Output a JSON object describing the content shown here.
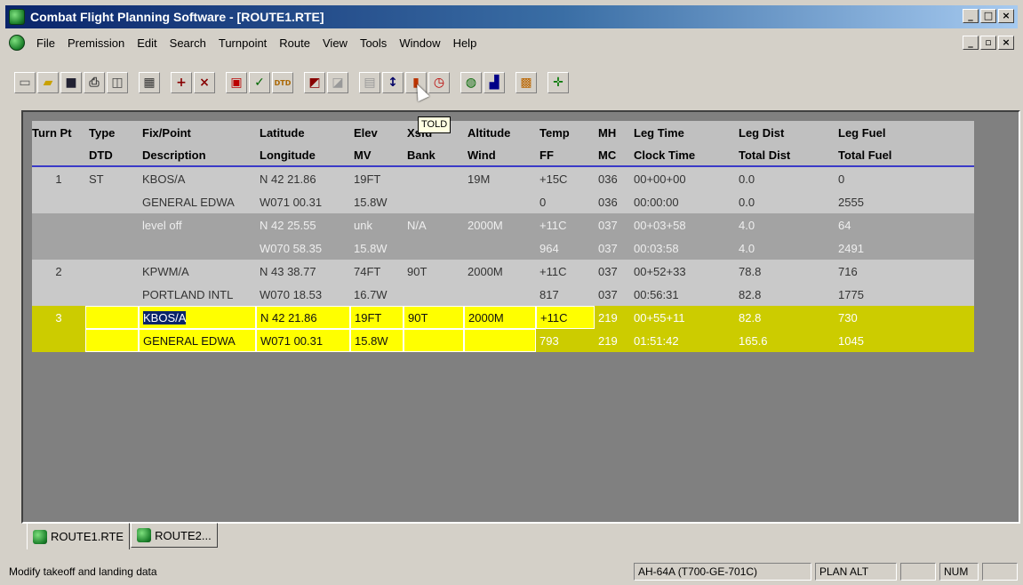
{
  "window": {
    "title": "Combat Flight Planning Software - [ROUTE1.RTE]"
  },
  "menu": [
    "File",
    "Premission",
    "Edit",
    "Search",
    "Turnpoint",
    "Route",
    "View",
    "Tools",
    "Window",
    "Help"
  ],
  "toolbar": {
    "buttons": [
      "new-icon",
      "open-icon",
      "save-icon",
      "print-icon",
      "print-preview-icon",
      "calculator-icon",
      "insert-turnpoint-icon",
      "delete-turnpoint-icon",
      "flight-plan-icon",
      "check-icon",
      "dtd-icon",
      "told-icon",
      "disabled-icon",
      "settings-icon",
      "vertical-icon",
      "weight-icon",
      "clock-icon",
      "globe-icon",
      "chart-icon",
      "dtd-load-icon",
      "crosshair-icon"
    ],
    "tooltip": "TOLD"
  },
  "grid": {
    "header_row1": [
      "Turn Pt",
      "Type",
      "Fix/Point",
      "Latitude",
      "Elev",
      "Xsfd",
      "Altitude",
      "Temp",
      "MH",
      "Leg Time",
      "Leg Dist",
      "Leg Fuel"
    ],
    "header_row2": [
      "",
      "DTD",
      "Description",
      "Longitude",
      "MV",
      "Bank",
      "Wind",
      "FF",
      "MC",
      "Clock Time",
      "Total Dist",
      "Total Fuel"
    ],
    "rows": [
      {
        "style": "light",
        "cells": [
          "1",
          "ST",
          "KBOS/A",
          "N 42 21.86",
          "19FT",
          "",
          "19M",
          "+15C",
          "036",
          "00+00+00",
          "0.0",
          "0"
        ]
      },
      {
        "style": "light",
        "cells": [
          "",
          "",
          "GENERAL EDWA",
          "W071 00.31",
          "15.8W",
          "",
          "",
          "0",
          "036",
          "00:00:00",
          "0.0",
          "2555"
        ]
      },
      {
        "style": "dark",
        "cells": [
          "",
          "",
          "level off",
          "N 42 25.55",
          "unk",
          "N/A",
          "2000M",
          "+11C",
          "037",
          "00+03+58",
          "4.0",
          "64"
        ]
      },
      {
        "style": "dark",
        "cells": [
          "",
          "",
          "",
          "W070 58.35",
          "15.8W",
          "",
          "",
          "964",
          "037",
          "00:03:58",
          "4.0",
          "2491"
        ]
      },
      {
        "style": "light",
        "cells": [
          "2",
          "",
          "KPWM/A",
          "N 43 38.77",
          "74FT",
          "90T",
          "2000M",
          "+11C",
          "037",
          "00+52+33",
          "78.8",
          "716"
        ]
      },
      {
        "style": "light",
        "cells": [
          "",
          "",
          "PORTLAND INTL",
          "W070 18.53",
          "16.7W",
          "",
          "",
          "817",
          "037",
          "00:56:31",
          "82.8",
          "1775"
        ]
      },
      {
        "style": "sel",
        "cells": [
          "3",
          "",
          "KBOS/A",
          "N 42 21.86",
          "19FT",
          "90T",
          "2000M",
          "+11C",
          "219",
          "00+55+11",
          "82.8",
          "730"
        ]
      },
      {
        "style": "sel",
        "cells": [
          "",
          "",
          "GENERAL EDWA",
          "W071 00.31",
          "15.8W",
          "",
          "",
          "793",
          "219",
          "01:51:42",
          "165.6",
          "1045"
        ]
      }
    ]
  },
  "tabs": [
    "ROUTE1.RTE",
    "ROUTE2..."
  ],
  "status": {
    "message": "Modify takeoff and landing data",
    "aircraft": "AH-64A (T700-GE-701C)",
    "mode": "PLAN ALT",
    "blank": "",
    "num": "NUM",
    "blank2": ""
  }
}
